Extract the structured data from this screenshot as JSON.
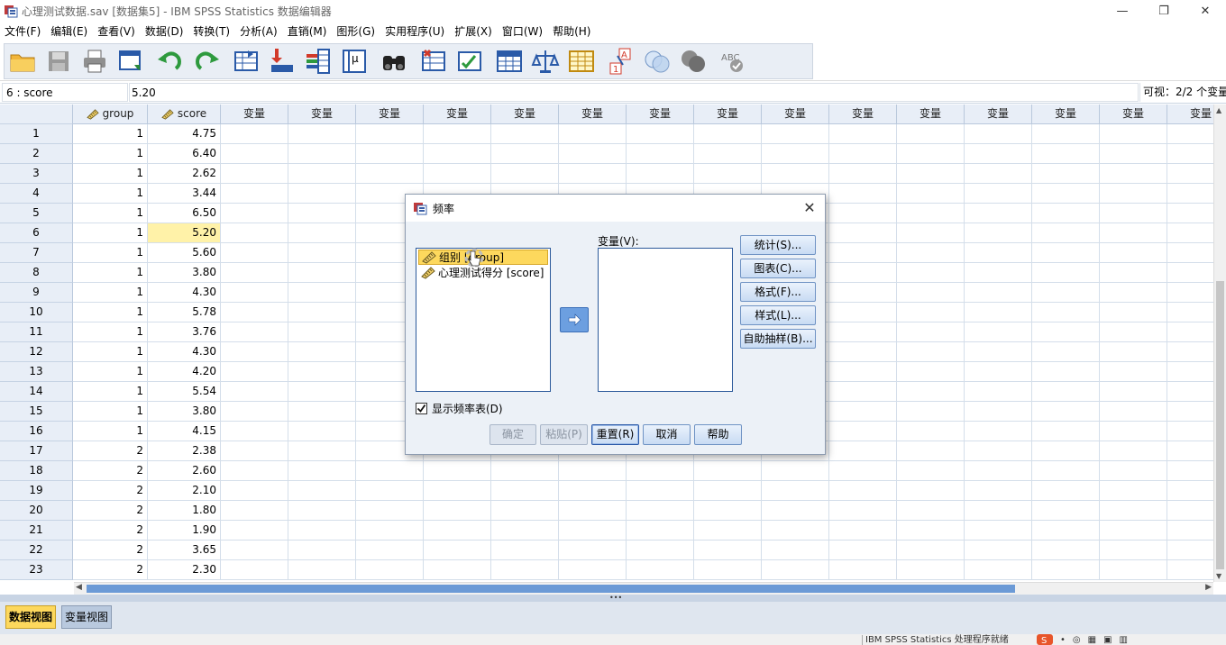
{
  "window": {
    "title": "心理测试数据.sav [数据集5] - IBM SPSS Statistics 数据编辑器",
    "minimize_glyph": "—",
    "restore_glyph": "❐",
    "close_glyph": "✕"
  },
  "menu": [
    "文件(F)",
    "编辑(E)",
    "查看(V)",
    "数据(D)",
    "转换(T)",
    "分析(A)",
    "直销(M)",
    "图形(G)",
    "实用程序(U)",
    "扩展(X)",
    "窗口(W)",
    "帮助(H)"
  ],
  "toolbar_icons": [
    "open-folder-icon",
    "save-icon",
    "print-icon",
    "dialog-recall-icon",
    "undo-icon",
    "redo-icon",
    "goto-case-icon",
    "goto-variable-icon",
    "variables-icon",
    "run-descriptives-icon",
    "find-icon",
    "insert-cases-icon",
    "insert-variable-icon",
    "split-file-icon",
    "weight-cases-icon",
    "select-cases-icon",
    "value-labels-icon",
    "use-sets-icon",
    "show-all-variables-icon",
    "spell-check-icon"
  ],
  "cellbar": {
    "ref": "6 : score",
    "value": "5.20",
    "visible": "可视：2/2 个变量"
  },
  "grid": {
    "columns": [
      "group",
      "score"
    ],
    "empty_col_label": "变量",
    "empty_col_count": 15,
    "rows": [
      {
        "n": "1",
        "group": "1",
        "score": "4.75"
      },
      {
        "n": "2",
        "group": "1",
        "score": "6.40"
      },
      {
        "n": "3",
        "group": "1",
        "score": "2.62"
      },
      {
        "n": "4",
        "group": "1",
        "score": "3.44"
      },
      {
        "n": "5",
        "group": "1",
        "score": "6.50"
      },
      {
        "n": "6",
        "group": "1",
        "score": "5.20"
      },
      {
        "n": "7",
        "group": "1",
        "score": "5.60"
      },
      {
        "n": "8",
        "group": "1",
        "score": "3.80"
      },
      {
        "n": "9",
        "group": "1",
        "score": "4.30"
      },
      {
        "n": "10",
        "group": "1",
        "score": "5.78"
      },
      {
        "n": "11",
        "group": "1",
        "score": "3.76"
      },
      {
        "n": "12",
        "group": "1",
        "score": "4.30"
      },
      {
        "n": "13",
        "group": "1",
        "score": "4.20"
      },
      {
        "n": "14",
        "group": "1",
        "score": "5.54"
      },
      {
        "n": "15",
        "group": "1",
        "score": "3.80"
      },
      {
        "n": "16",
        "group": "1",
        "score": "4.15"
      },
      {
        "n": "17",
        "group": "2",
        "score": "2.38"
      },
      {
        "n": "18",
        "group": "2",
        "score": "2.60"
      },
      {
        "n": "19",
        "group": "2",
        "score": "2.10"
      },
      {
        "n": "20",
        "group": "2",
        "score": "1.80"
      },
      {
        "n": "21",
        "group": "2",
        "score": "1.90"
      },
      {
        "n": "22",
        "group": "2",
        "score": "3.65"
      },
      {
        "n": "23",
        "group": "2",
        "score": "2.30"
      }
    ],
    "selected_row": 6,
    "selected_col": "score"
  },
  "tabs": {
    "data_view": "数据视图",
    "variable_view": "变量视图"
  },
  "statusbar": {
    "text": "IBM SPSS Statistics 处理程序就绪"
  },
  "dialog": {
    "title": "频率",
    "source_items": [
      "组别 [group]",
      "心理测试得分 [score]"
    ],
    "target_label": "变量(V):",
    "side_buttons": [
      "统计(S)...",
      "图表(C)...",
      "格式(F)...",
      "样式(L)...",
      "自助抽样(B)..."
    ],
    "checkbox_label": "显示频率表(D)",
    "checkbox_checked": true,
    "buttons": {
      "ok": "确定",
      "paste": "粘贴(P)",
      "reset": "重置(R)",
      "cancel": "取消",
      "help": "帮助"
    },
    "close_glyph": "✕"
  },
  "colors": {
    "selected_cell": "#fff2a8",
    "selected_item": "#fdd85d",
    "header_bg": "#e8eef7",
    "accent_blue": "#6c9fe0"
  }
}
